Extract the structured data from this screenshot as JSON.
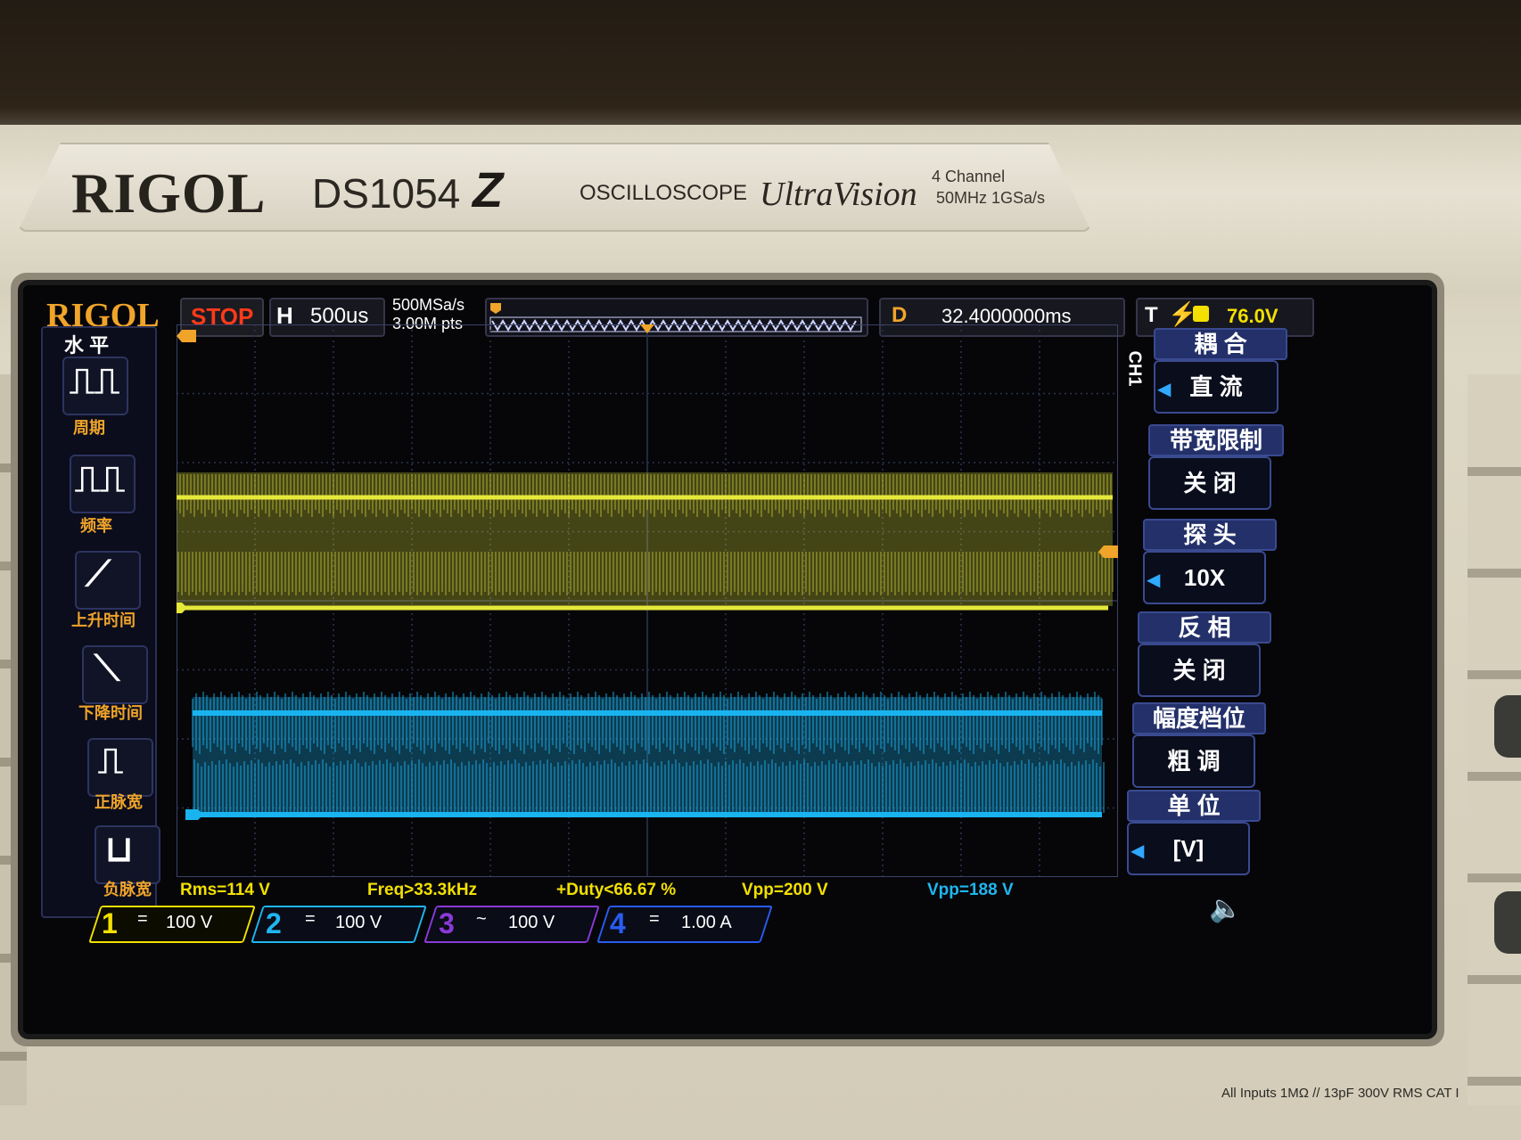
{
  "device": {
    "brand": "RIGOL",
    "model": "DS1054",
    "model_suffix": "Z",
    "type": "OSCILLOSCOPE",
    "series": "UltraVision",
    "channels_spec": "4 Channel",
    "bandwidth_spec": "50MHz  1GSa/s",
    "input_rating": "All Inputs  1MΩ // 13pF  300V RMS  CAT I"
  },
  "status_bar": {
    "logo": "RIGOL",
    "run_state": "STOP",
    "timebase_mode": "H",
    "timebase": "500us",
    "sample_rate": "500MSa/s",
    "memory_depth": "3.00M pts",
    "delay_label": "D",
    "delay": "32.4000000ms",
    "trigger_label": "T",
    "trigger_level": "76.0V"
  },
  "measure_panel": {
    "title": "水 平",
    "items": [
      {
        "label": "周期",
        "icon": "period-icon"
      },
      {
        "label": "频率",
        "icon": "frequency-icon"
      },
      {
        "label": "上升时间",
        "icon": "rise-time-icon"
      },
      {
        "label": "下降时间",
        "icon": "fall-time-icon"
      },
      {
        "label": "正脉宽",
        "icon": "positive-width-icon"
      },
      {
        "label": "负脉宽",
        "icon": "negative-width-icon"
      }
    ]
  },
  "measurements": [
    {
      "text": "Rms=114 V",
      "color": "#f3e000"
    },
    {
      "text": "Freq>33.3kHz",
      "color": "#f3e000"
    },
    {
      "text": "+Duty<66.67 %",
      "color": "#f3e000"
    },
    {
      "text": "Vpp=200 V",
      "color": "#f3e000"
    },
    {
      "text": "Vpp=188 V",
      "color": "#1fb6f0"
    }
  ],
  "channels": [
    {
      "num": "1",
      "coupling": "=",
      "scale": "100 V",
      "color": "#f3e000",
      "active": true
    },
    {
      "num": "2",
      "coupling": "=",
      "scale": "100 V",
      "color": "#1fb6f0",
      "active": false
    },
    {
      "num": "3",
      "coupling": "~",
      "scale": "100 V",
      "color": "#8a3ad8",
      "active": false
    },
    {
      "num": "4",
      "coupling": "=",
      "scale": "1.00 A",
      "color": "#2a5cf0",
      "active": false
    }
  ],
  "softkey_menu": {
    "channel_label": "CH1",
    "items": [
      {
        "title": "耦 合",
        "value": "直 流"
      },
      {
        "title": "带宽限制",
        "value": "关 闭"
      },
      {
        "title": "探 头",
        "value": "10X"
      },
      {
        "title": "反 相",
        "value": "关 闭"
      },
      {
        "title": "幅度档位",
        "value": "粗 调"
      },
      {
        "title": "单 位",
        "value": "[V]"
      }
    ]
  },
  "waveforms": {
    "ch1_color": "#e6e83a",
    "ch2_color": "#19b4ef"
  }
}
